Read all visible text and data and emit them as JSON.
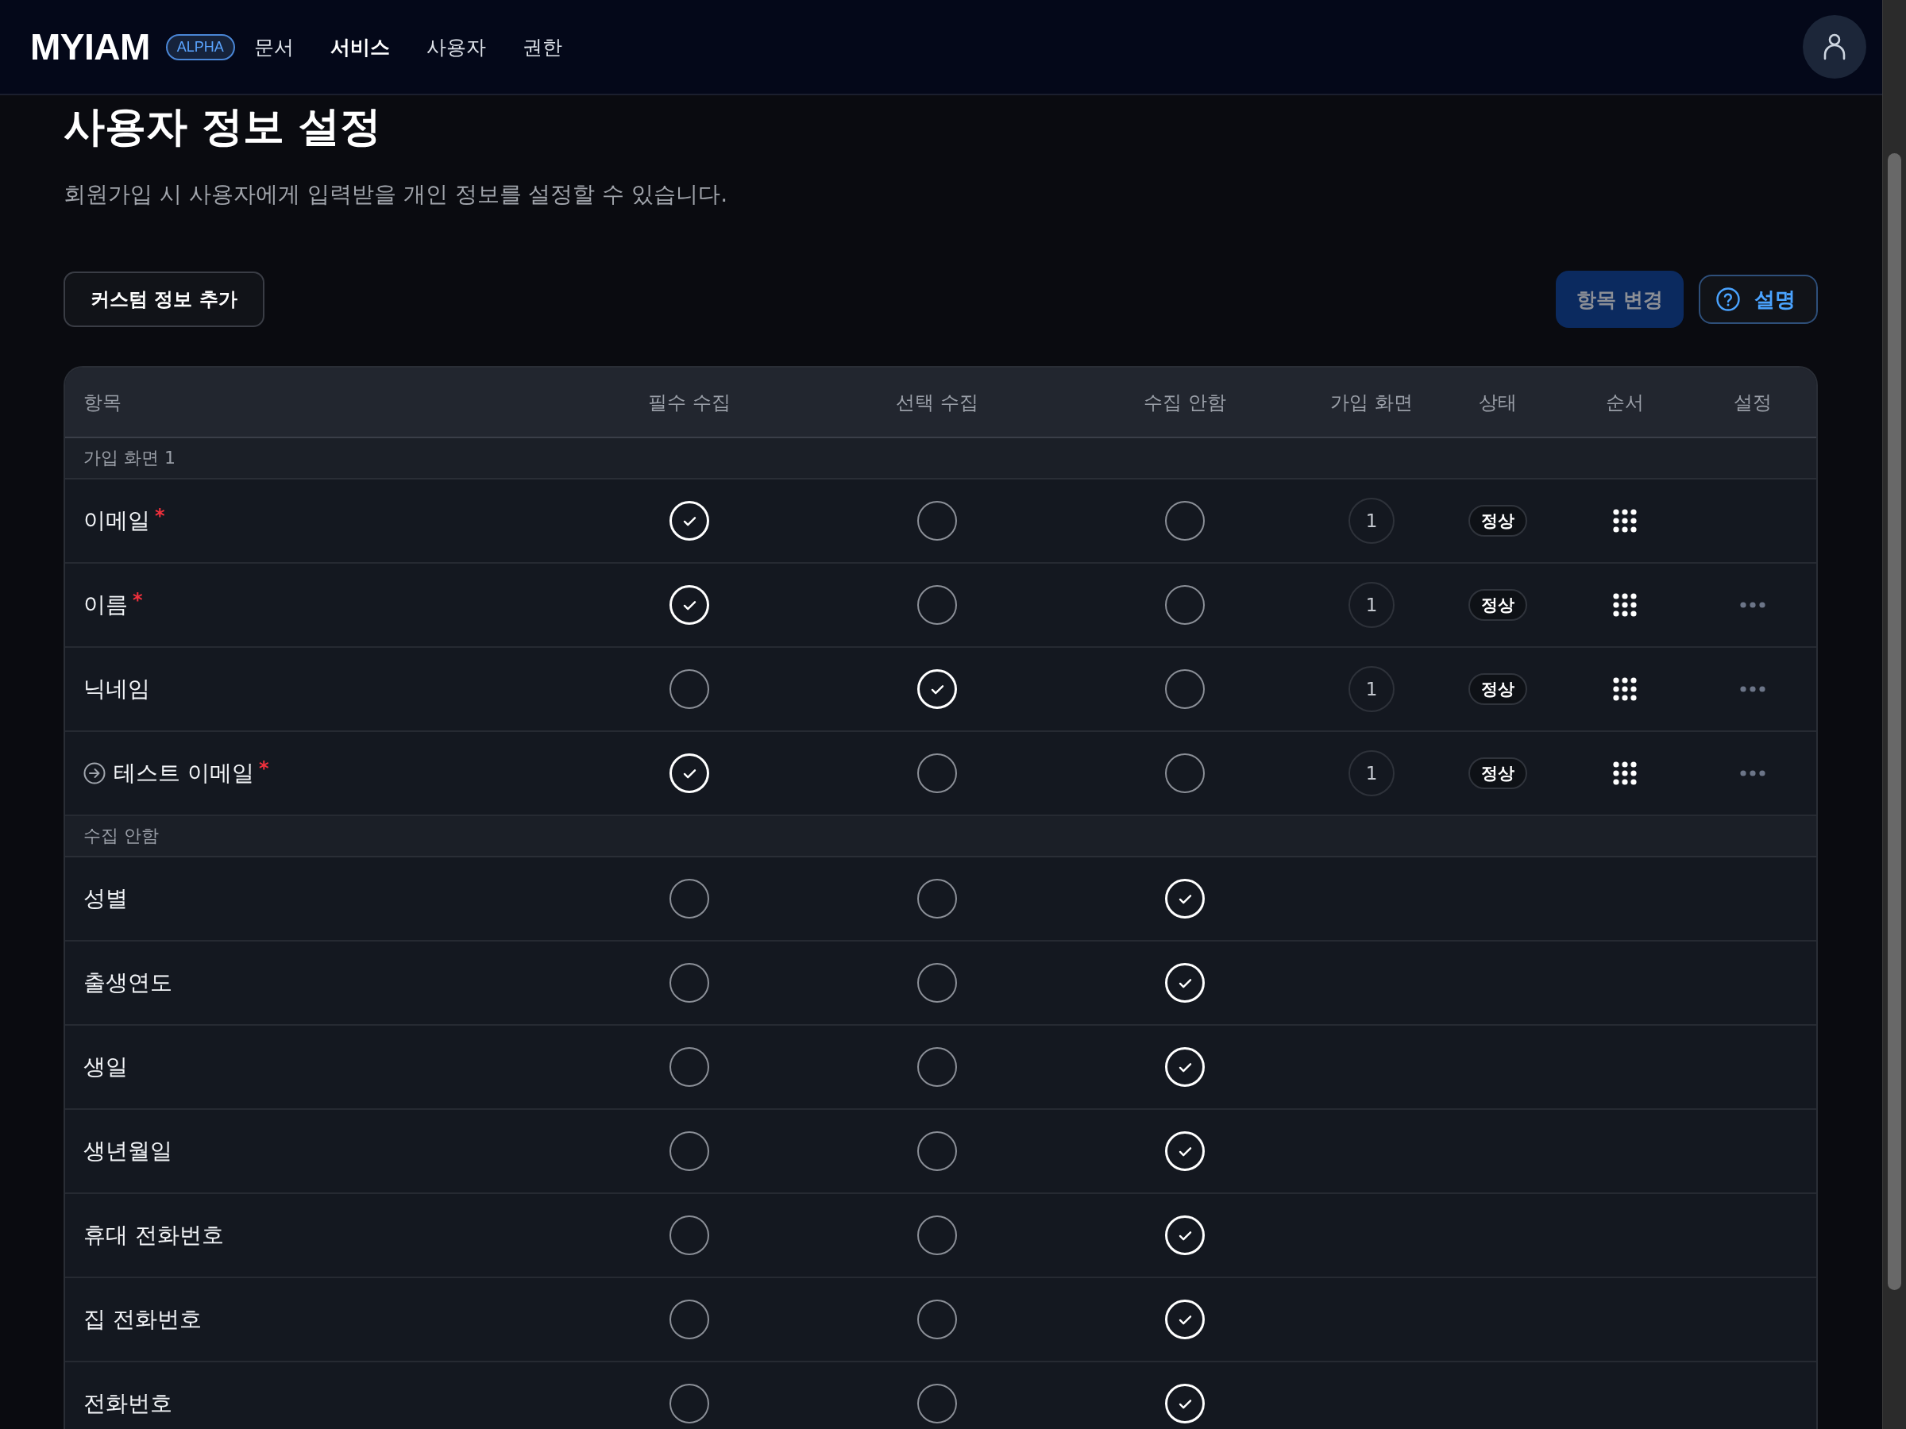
{
  "header": {
    "logo": "MYIAM",
    "badge": "ALPHA",
    "nav": [
      {
        "label": "문서",
        "selected": false
      },
      {
        "label": "서비스",
        "selected": true
      },
      {
        "label": "사용자",
        "selected": false
      },
      {
        "label": "권한",
        "selected": false
      }
    ]
  },
  "page": {
    "title": "사용자 정보 설정",
    "subtitle": "회원가입 시 사용자에게 입력받을 개인 정보를 설정할 수 있습니다.",
    "add_button": "커스텀 정보 추가",
    "change_button": {
      "label": "항목 변경",
      "disabled": true
    },
    "help_button": "설명"
  },
  "table": {
    "columns": [
      "항목",
      "필수 수집",
      "선택 수집",
      "수집 안함",
      "가입 화면",
      "상태",
      "순서",
      "설정"
    ],
    "groups": [
      {
        "label": "가입 화면 1",
        "rows": [
          {
            "kind": "standard",
            "name": "이메일",
            "required_mark": "*",
            "choices": [
              {
                "selected": true
              },
              {
                "selected": false
              },
              {
                "selected": false
              }
            ],
            "page": "1",
            "status": "정상",
            "reorderable": true,
            "menu": false
          },
          {
            "kind": "standard",
            "name": "이름",
            "required_mark": "*",
            "choices": [
              {
                "selected": true
              },
              {
                "selected": false
              },
              {
                "selected": false
              }
            ],
            "page": "1",
            "status": "정상",
            "reorderable": true,
            "menu": true
          },
          {
            "kind": "standard",
            "name": "닉네임",
            "choices": [
              {
                "selected": false
              },
              {
                "selected": true
              },
              {
                "selected": false
              }
            ],
            "page": "1",
            "status": "정상",
            "reorderable": true,
            "menu": true
          },
          {
            "kind": "custom",
            "name": "테스트 이메일",
            "required_mark": "*",
            "choices": [
              {
                "selected": true
              },
              {
                "selected": false
              },
              {
                "selected": false
              }
            ],
            "page": "1",
            "status": "정상",
            "reorderable": true,
            "menu": true
          }
        ]
      },
      {
        "label": "수집 안함",
        "rows": [
          {
            "kind": "standard",
            "name": "성별",
            "choices": [
              {
                "selected": false
              },
              {
                "selected": false
              },
              {
                "selected": true
              }
            ]
          },
          {
            "kind": "standard",
            "name": "출생연도",
            "choices": [
              {
                "selected": false
              },
              {
                "selected": false
              },
              {
                "selected": true
              }
            ]
          },
          {
            "kind": "standard",
            "name": "생일",
            "choices": [
              {
                "selected": false
              },
              {
                "selected": false
              },
              {
                "selected": true
              }
            ]
          },
          {
            "kind": "standard",
            "name": "생년월일",
            "choices": [
              {
                "selected": false
              },
              {
                "selected": false
              },
              {
                "selected": true
              }
            ]
          },
          {
            "kind": "standard",
            "name": "휴대 전화번호",
            "choices": [
              {
                "selected": false
              },
              {
                "selected": false
              },
              {
                "selected": true
              }
            ]
          },
          {
            "kind": "standard",
            "name": "집 전화번호",
            "choices": [
              {
                "selected": false
              },
              {
                "selected": false
              },
              {
                "selected": true
              }
            ]
          },
          {
            "kind": "standard",
            "name": "전화번호",
            "choices": [
              {
                "selected": false
              },
              {
                "selected": false
              },
              {
                "selected": true
              }
            ]
          }
        ]
      }
    ]
  }
}
